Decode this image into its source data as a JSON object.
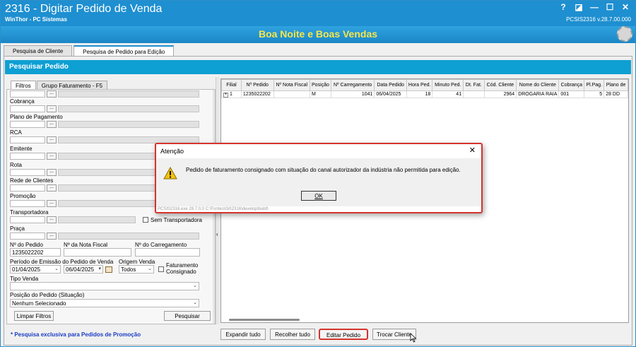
{
  "window": {
    "title": "2316 - Digitar Pedido de Venda",
    "subtitle": "WinThor - PC Sistemas",
    "version": "PCSIS2316  v.28.7.00.000",
    "controls": [
      "?",
      "◪",
      "—",
      "☐",
      "✕"
    ]
  },
  "banner": {
    "greeting": "Boa Noite e Boas Vendas"
  },
  "tabs": [
    {
      "label": "Pesquisa de Cliente",
      "active": false
    },
    {
      "label": "Pesquisa de Pedido para Edição",
      "active": true
    }
  ],
  "section_title": "Pesquisar Pedido",
  "filter_tabs": [
    {
      "label": "Filtros",
      "active": true
    },
    {
      "label": "Grupo Faturamento - F5",
      "active": false
    }
  ],
  "filters": {
    "ellipsis": "...",
    "labels": {
      "cobranca": "Cobrança",
      "plano_pagamento": "Plano de Pagamento",
      "rca": "RCA",
      "emitente": "Emitente",
      "rota": "Rota",
      "rede_clientes": "Rede de Clientes",
      "promocao": "Promoção",
      "transportadora": "Transportadora",
      "praca": "Praça",
      "num_pedido": "Nº do Pedido",
      "num_nota": "Nº da Nota Fiscal",
      "num_carregamento": "Nº do Carregamento",
      "periodo": "Período de Emissão do Pedido de Venda",
      "origem_venda": "Origem Venda",
      "tipo_venda": "Tipo Venda",
      "posicao": "Posição do Pedido (Situação)"
    },
    "sem_transportadora": "Sem Transportadora",
    "faturamento_consignado": "Faturamento Consignado",
    "values": {
      "num_pedido": "1235022202",
      "data_inicio": "01/04/2025",
      "data_fim": "06/04/2025",
      "origem_venda": "Todos",
      "tipo_venda": "",
      "posicao": "Nenhum Selecionado"
    },
    "limpar_label": "Limpar Filtros",
    "pesquisar_label": "Pesquisar",
    "promo_note": "* Pesquisa exclusiva para Pedidos de Promoção"
  },
  "grid": {
    "columns": [
      "Filial",
      "Nº Pedido",
      "Nº Nota Fiscal",
      "Posição",
      "Nº Carregamento",
      "Data Pedido",
      "Hora Ped.",
      "Minuto Ped.",
      "Dt. Fat.",
      "Cód. Cliente",
      "Nome do Cliente",
      "Cobrança",
      "Pl.Pag.",
      "Plano de"
    ],
    "rows": [
      [
        "1",
        "1235022202",
        "",
        "M",
        "1041",
        "06/04/2025",
        "18",
        "41",
        "",
        "2964",
        "DROGARIA RAIA",
        "001",
        "5",
        "28 DD"
      ]
    ],
    "expand_symbol": "+"
  },
  "bottom_buttons": {
    "expandir": "Expandir tudo",
    "recolher": "Recolher tudo",
    "editar": "Editar Pedido",
    "trocar": "Trocar Cliente"
  },
  "dialog": {
    "title": "Atenção",
    "close": "✕",
    "message": "Pedido de faturamento consignado com situação do canal autorizador da indústria não permitida para edição.",
    "ok_label": "OK",
    "footer": "PCSIS2316.exe 28.7.0.0 C:\\Fontes\\Git\\2316\\develop\\build\\"
  }
}
